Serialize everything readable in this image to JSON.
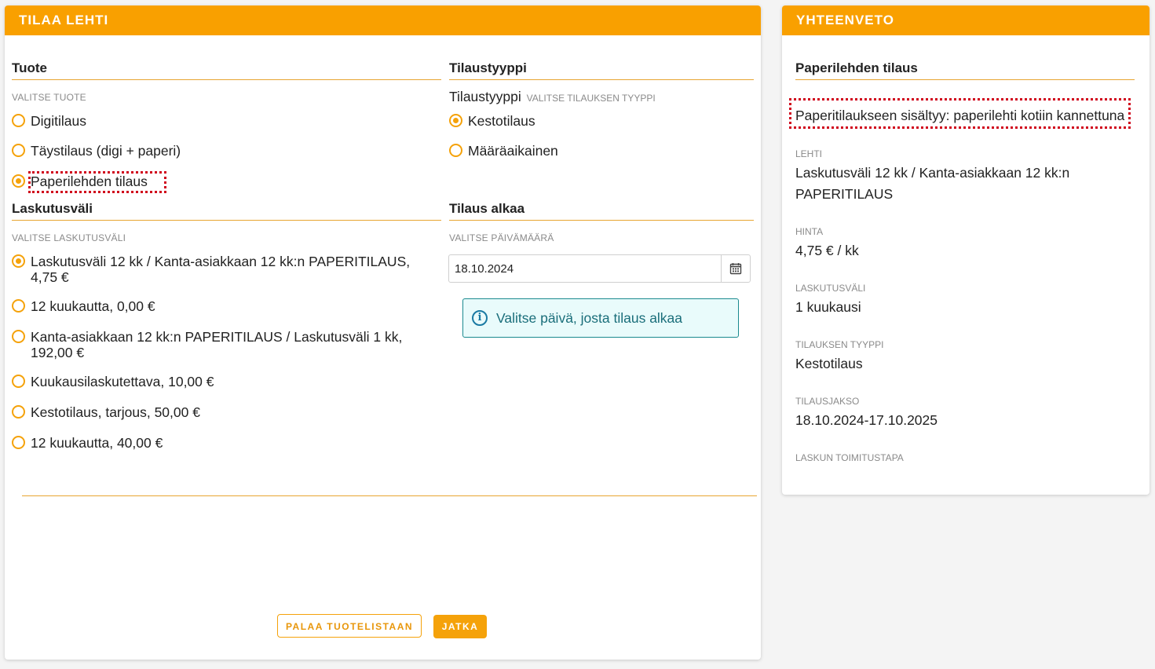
{
  "order": {
    "header": "TILAA LEHTI",
    "product": {
      "title": "Tuote",
      "hint": "VALITSE TUOTE",
      "options": [
        {
          "label": "Digitilaus",
          "checked": false
        },
        {
          "label": "Täystilaus (digi + paperi)",
          "checked": false
        },
        {
          "label": "Paperilehden tilaus",
          "checked": true
        }
      ]
    },
    "subscription_type": {
      "title": "Tilaustyyppi",
      "label": "Tilaustyyppi",
      "hint": "VALITSE TILAUKSEN TYYPPI",
      "options": [
        {
          "label": "Kestotilaus",
          "checked": true
        },
        {
          "label": "Määräaikainen",
          "checked": false
        }
      ]
    },
    "billing": {
      "title": "Laskutusväli",
      "hint": "VALITSE LASKUTUSVÄLI",
      "options": [
        {
          "label": "Laskutusväli 12 kk / Kanta-asiakkaan 12 kk:n PAPERITILAUS, 4,75 €",
          "checked": true
        },
        {
          "label": "12 kuukautta, 0,00 €",
          "checked": false
        },
        {
          "label": "Kanta-asiakkaan 12 kk:n PAPERITILAUS / Laskutusväli 1 kk, 192,00 €",
          "checked": false
        },
        {
          "label": "Kuukausilaskutettava, 10,00 €",
          "checked": false
        },
        {
          "label": "Kestotilaus, tarjous, 50,00 €",
          "checked": false
        },
        {
          "label": "12 kuukautta, 40,00 €",
          "checked": false
        }
      ]
    },
    "start": {
      "title": "Tilaus alkaa",
      "hint": "VALITSE PÄIVÄMÄÄRÄ",
      "date_value": "18.10.2024",
      "info": "Valitse päivä, josta tilaus alkaa"
    },
    "buttons": {
      "back": "PALAA TUOTELISTAAN",
      "continue": "JATKA"
    }
  },
  "summary": {
    "header": "YHTEENVETO",
    "title": "Paperilehden tilaus",
    "included": "Paperitilaukseen sisältyy: paperilehti kotiin kannettuna",
    "fields": [
      {
        "label": "LEHTI",
        "value": "Laskutusväli 12 kk / Kanta-asiakkaan 12 kk:n PAPERITILAUS"
      },
      {
        "label": "HINTA",
        "value": "4,75 € / kk"
      },
      {
        "label": "LASKUTUSVÄLI",
        "value": "1 kuukausi"
      },
      {
        "label": "TILAUKSEN TYYPPI",
        "value": "Kestotilaus"
      },
      {
        "label": "TILAUSJAKSO",
        "value": "18.10.2024-17.10.2025"
      },
      {
        "label": "LASKUN TOIMITUSTAPA",
        "value": ""
      }
    ]
  },
  "colors": {
    "accent": "#f9a000",
    "highlight": "#d0021b",
    "info_border": "#1a8a8f"
  }
}
